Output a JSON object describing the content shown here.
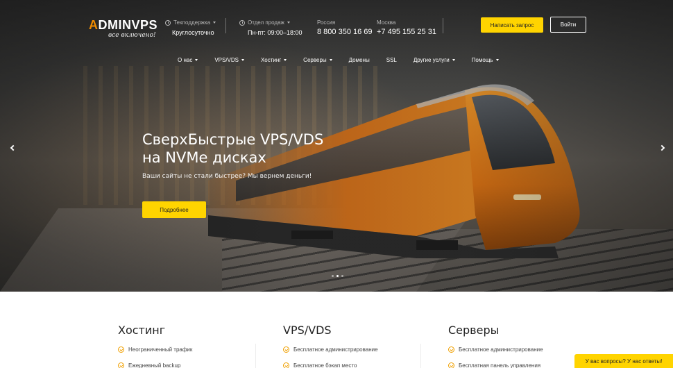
{
  "logo": {
    "text_a": "A",
    "text_rest": "DMINVPS",
    "slogan": "все включено!"
  },
  "header": {
    "support": {
      "label": "Техподдержка",
      "value": "Круглосуточно"
    },
    "sales": {
      "label": "Отдел продаж",
      "value": "Пн-пт: 09:00–18:00"
    },
    "russia": {
      "label": "Россия",
      "value": "8 800 350 16 69"
    },
    "moscow": {
      "label": "Москва",
      "value": "+7 495 155 25 31"
    },
    "request_button": "Написать запрос",
    "login_button": "Войти"
  },
  "nav": {
    "items": [
      {
        "label": "О нас",
        "dropdown": true
      },
      {
        "label": "VPS/VDS",
        "dropdown": true
      },
      {
        "label": "Хостинг",
        "dropdown": true
      },
      {
        "label": "Серверы",
        "dropdown": true
      },
      {
        "label": "Домены",
        "dropdown": false
      },
      {
        "label": "SSL",
        "dropdown": false
      },
      {
        "label": "Другие услуги",
        "dropdown": true
      },
      {
        "label": "Помощь",
        "dropdown": true
      }
    ]
  },
  "hero": {
    "title_line1": "СверхБыстрые VPS/VDS",
    "title_line2": "на NVMe дисках",
    "subtitle": "Ваши сайты не стали быстрее? Мы вернем деньги!",
    "button": "Подробнее",
    "slides_total": 3,
    "slide_active": 2
  },
  "columns": [
    {
      "title": "Хостинг",
      "features": [
        "Неограниченный трафик",
        "Ежедневный backup"
      ]
    },
    {
      "title": "VPS/VDS",
      "features": [
        "Бесплатное администрирование",
        "Бесплатное бэкап место"
      ]
    },
    {
      "title": "Серверы",
      "features": [
        "Бесплатное администрирование",
        "Бесплатная панель управления"
      ]
    }
  ],
  "chat": {
    "label": "У вас вопросы? У нас ответы!"
  },
  "colors": {
    "accent": "#ffd400",
    "brand_orange": "#f08c00",
    "check": "#f0a000"
  }
}
